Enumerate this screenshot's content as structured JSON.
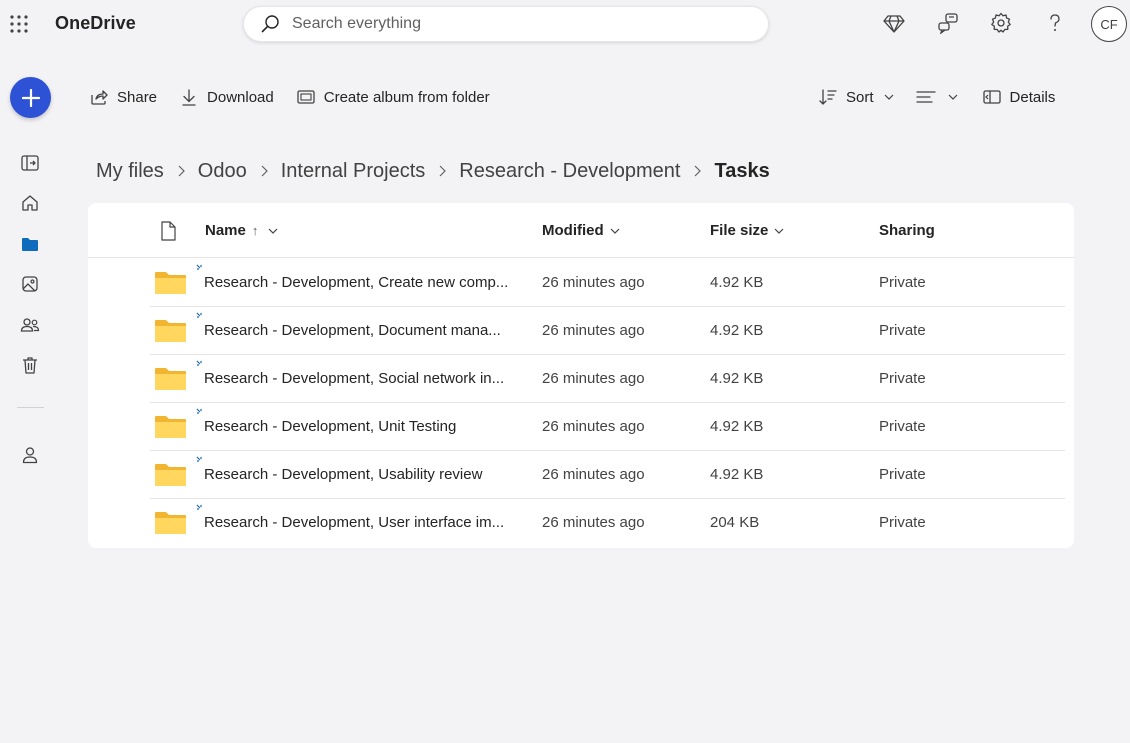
{
  "app": {
    "name": "OneDrive"
  },
  "search": {
    "placeholder": "Search everything"
  },
  "user": {
    "initials": "CF"
  },
  "toolbar": {
    "share": "Share",
    "download": "Download",
    "create_album": "Create album from folder",
    "sort": "Sort",
    "details": "Details"
  },
  "breadcrumb": [
    "My files",
    "Odoo",
    "Internal Projects",
    "Research - Development",
    "Tasks"
  ],
  "table": {
    "columns": {
      "name": "Name",
      "modified": "Modified",
      "size": "File size",
      "sharing": "Sharing"
    },
    "sort_indicator": "↑",
    "rows": [
      {
        "name": "Research - Development,  Create new comp...",
        "modified": "26 minutes ago",
        "size": "4.92 KB",
        "sharing": "Private"
      },
      {
        "name": "Research - Development,  Document mana...",
        "modified": "26 minutes ago",
        "size": "4.92 KB",
        "sharing": "Private"
      },
      {
        "name": "Research - Development,  Social network in...",
        "modified": "26 minutes ago",
        "size": "4.92 KB",
        "sharing": "Private"
      },
      {
        "name": "Research - Development,  Unit Testing",
        "modified": "26 minutes ago",
        "size": "4.92 KB",
        "sharing": "Private"
      },
      {
        "name": "Research - Development,  Usability review",
        "modified": "26 minutes ago",
        "size": "4.92 KB",
        "sharing": "Private"
      },
      {
        "name": "Research - Development,  User interface im...",
        "modified": "26 minutes ago",
        "size": "204 KB",
        "sharing": "Private"
      }
    ]
  },
  "colors": {
    "accent": "#2e52d6",
    "folder": "#ffd75e",
    "folder_dark": "#f2b530",
    "new_marker": "#0f6cbd"
  },
  "icons": {
    "top": [
      "waffle-icon",
      "search-icon",
      "diamond-icon",
      "chat-feedback-icon",
      "gear-icon",
      "help-icon"
    ],
    "rail": [
      "plus-icon",
      "sidebar-toggle-icon",
      "home-icon",
      "folder-icon",
      "photos-icon",
      "people-icon",
      "recycle-bin-icon",
      "person-icon"
    ]
  }
}
